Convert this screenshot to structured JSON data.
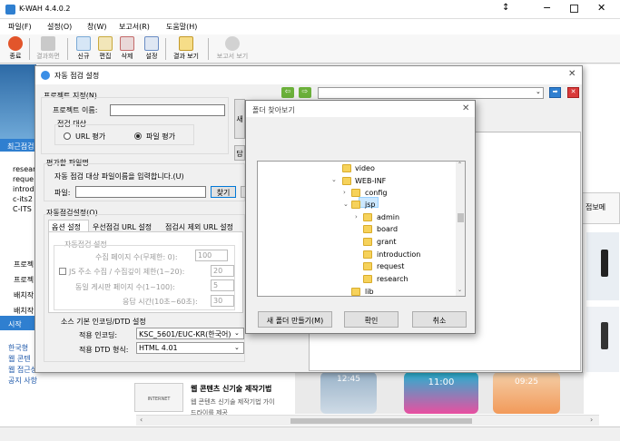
{
  "app": {
    "title": "K-WAH 4.4.0.2",
    "min_icon": "minimize-icon",
    "max_icon": "maximize-icon",
    "close_icon": "close-icon",
    "extra_icon": "restore-icon"
  },
  "menu": [
    "파일(F)",
    "설정(O)",
    "창(W)",
    "보고서(R)",
    "도움말(H)"
  ],
  "toolbar": [
    "종료",
    "결과화면",
    "신규",
    "편집",
    "삭제",
    "설정",
    "결과 보기",
    "보고서 보기"
  ],
  "background": {
    "recent_label": "최근점검",
    "recent_items": [
      "researc",
      "reque",
      "introd",
      "c-its2",
      "C-ITS"
    ],
    "project_items": [
      "프로젝",
      "프로젝",
      "배치작",
      "배치작"
    ],
    "start_label": "시작",
    "links": [
      "한국형",
      "웹 콘텐",
      "웹 접근성 뉴스",
      "공지 사항"
    ],
    "news_title": "웹 콘텐츠 신기술 제작기법",
    "news_desc": "웹 콘텐츠 신기술 제작기법 가이",
    "news_desc2": "드라이를 제공",
    "thumb_label": "INTERNET",
    "right_tab": "접보메",
    "phone_times": [
      "12:45",
      "11:00",
      "09:25"
    ]
  },
  "dialog": {
    "title": "자동 점검 설정",
    "project_group": "프로젝트 지정(N)",
    "project_name_label": "프로젝트 이름:",
    "project_name_value": "",
    "target_label": "점검 대상",
    "url_option": "URL 평가",
    "file_option": "파일 평가",
    "file_option_selected": true,
    "side_btn_1": "새",
    "side_btn_2": "담",
    "eval_file_group": "평가할 파일명",
    "eval_file_hint": "자동 점검 대상 파일이름을 입력합니다.(U)",
    "file_label": "파일:",
    "file_value": "",
    "find_button": "찾기",
    "auto_group": "자동점검설정(O)",
    "tabs": [
      "옵션 설정",
      "우선점검 URL 설정",
      "점검시 제외 URL 설정"
    ],
    "auto_sub": "자동점검 설정",
    "rows": [
      {
        "label": "수집 페이지 수(무제한: 0):",
        "value": "100"
      },
      {
        "label": "JS 주소 수집  / 수집깊이 제한(1~20):",
        "value": "20"
      },
      {
        "label": "동일 게시판 페이지 수(1~100):",
        "value": "5"
      },
      {
        "label": "응답 시간(10초~60초):",
        "value": "30"
      }
    ],
    "encoding_group": "소스 기본 인코딩/DTD 설정",
    "encoding_label": "적용 인코딩:",
    "encoding_value": "KSC_5601/EUC-KR(한국어)",
    "dtd_label": "적용 DTD 형식:",
    "dtd_value": "HTML 4.01",
    "close_icon": "close-icon"
  },
  "browser": {
    "address_value": "",
    "back_icon": "back-arrow-icon",
    "forward_icon": "forward-arrow-icon",
    "go_icon": "go-icon",
    "stop_icon": "stop-icon"
  },
  "folder_dialog": {
    "title": "폴더 찾아보기",
    "items": [
      {
        "label": "video",
        "level": 1,
        "chevron": ""
      },
      {
        "label": "WEB-INF",
        "level": 1,
        "chevron": "v"
      },
      {
        "label": "config",
        "level": 2,
        "chevron": ">"
      },
      {
        "label": "jsp",
        "level": 2,
        "chevron": "v",
        "selected": true
      },
      {
        "label": "admin",
        "level": 3,
        "chevron": ">"
      },
      {
        "label": "board",
        "level": 3,
        "chevron": ""
      },
      {
        "label": "grant",
        "level": 3,
        "chevron": ""
      },
      {
        "label": "introduction",
        "level": 3,
        "chevron": ""
      },
      {
        "label": "request",
        "level": 3,
        "chevron": ""
      },
      {
        "label": "research",
        "level": 3,
        "chevron": ""
      },
      {
        "label": "lib",
        "level": 2,
        "chevron": ""
      }
    ],
    "new_folder_button": "새 폴더 만들기(M)",
    "ok_button": "확인",
    "cancel_button": "취소"
  },
  "colors": {
    "accent": "#2f7fd0",
    "selected": "#cce8ff",
    "folder": "#f6d25b"
  }
}
